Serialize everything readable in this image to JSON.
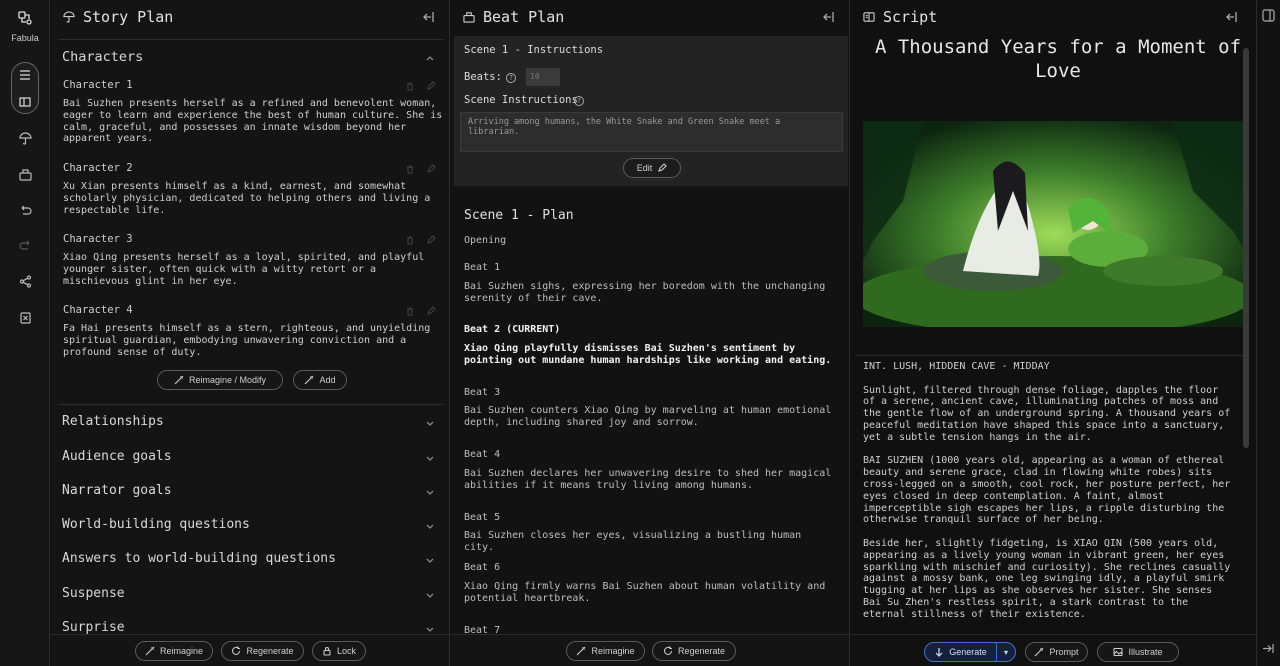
{
  "rail": {
    "logo_label": "Fabula"
  },
  "story_plan": {
    "title": "Story Plan",
    "characters_title": "Characters",
    "characters": [
      {
        "label": "Character 1",
        "text": "Bai Suzhen presents herself as a refined and benevolent woman, eager to learn and experience the best of human culture. She is calm, graceful, and possesses an innate wisdom beyond her apparent years."
      },
      {
        "label": "Character 2",
        "text": "Xu Xian presents himself as a kind, earnest, and somewhat scholarly physician, dedicated to helping others and living a respectable life."
      },
      {
        "label": "Character 3",
        "text": "Xiao Qing presents herself as a loyal, spirited, and playful younger sister, often quick with a witty retort or a mischievous glint in her eye."
      },
      {
        "label": "Character 4",
        "text": "Fa Hai presents himself as a stern, righteous, and unyielding spiritual guardian, embodying unwavering conviction and a profound sense of duty."
      }
    ],
    "reimagine_modify": "Reimagine / Modify",
    "add": "Add",
    "sections": [
      "Relationships",
      "Audience goals",
      "Narrator goals",
      "World-building questions",
      "Answers to world-building questions",
      "Suspense",
      "Surprise"
    ],
    "footer": {
      "reimagine": "Reimagine",
      "regenerate": "Regenerate",
      "lock": "Lock"
    }
  },
  "beat_plan": {
    "title": "Beat Plan",
    "instructions_title": "Scene 1 - Instructions",
    "beats_label": "Beats:",
    "beats_value": "10",
    "scene_instructions_label": "Scene Instructions",
    "scene_instructions": "Arriving among humans, the White Snake and Green Snake meet a librarian.",
    "edit": "Edit",
    "plan_title": "Scene 1 - Plan",
    "opening": "Opening",
    "beats": [
      {
        "label": "Beat 1",
        "text": "Bai Suzhen sighs, expressing her boredom with the unchanging serenity of their cave."
      },
      {
        "label": "Beat 2 (CURRENT)",
        "text": "Xiao Qing playfully dismisses Bai Suzhen's sentiment by pointing out mundane human hardships like working and eating."
      },
      {
        "label": "Beat 3",
        "text": "Bai Suzhen counters Xiao Qing by marveling at human emotional depth, including shared joy and sorrow."
      },
      {
        "label": "Beat 4",
        "text": "Bai Suzhen declares her unwavering desire to shed her magical abilities if it means truly living among humans."
      },
      {
        "label": "Beat 5",
        "text": "Bai Suzhen closes her eyes, visualizing a bustling human city."
      },
      {
        "label": "Beat 6",
        "text": "Xiao Qing firmly warns Bai Suzhen about human volatility and potential heartbreak."
      },
      {
        "label": "Beat 7",
        "text": ""
      }
    ],
    "footer": {
      "reimagine": "Reimagine",
      "regenerate": "Regenerate"
    }
  },
  "script": {
    "title": "Script",
    "doc_title": "A Thousand Years for a Moment of Love",
    "paragraphs": [
      "INT. LUSH, HIDDEN CAVE - MIDDAY",
      "Sunlight, filtered through dense foliage, dapples the floor of a serene, ancient cave, illuminating patches of moss and the gentle flow of an underground spring. A thousand years of peaceful meditation have shaped this space into a sanctuary, yet a subtle tension hangs in the air.",
      "BAI SUZHEN (1000 years old, appearing as a woman of ethereal beauty and serene grace, clad in flowing white robes) sits cross-legged on a smooth, cool rock, her posture perfect, her eyes closed in deep contemplation. A faint, almost imperceptible sigh escapes her lips, a ripple disturbing the otherwise tranquil surface of her being.",
      "Beside her, slightly fidgeting, is XIAO QIN (500 years old, appearing as a lively young woman in vibrant green, her eyes sparkling with mischief and curiosity). She reclines casually against a mossy bank, one leg swinging idly, a playful smirk tugging at her lips as she observes her sister. She senses Bai Su Zhen's restless spirit, a stark contrast to the eternal stillness of their existence."
    ],
    "footer": {
      "generate": "Generate",
      "prompt": "Prompt",
      "illustrate": "Illustrate"
    }
  }
}
